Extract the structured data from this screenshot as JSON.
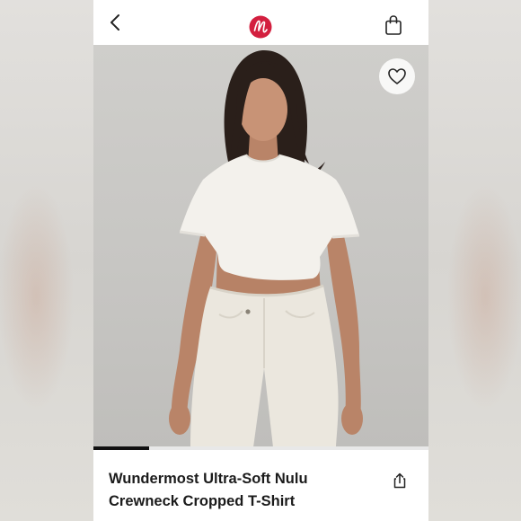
{
  "header": {
    "back_icon": "chevron-left-icon",
    "logo_icon": "lululemon-logo",
    "bag_icon": "shopping-bag-icon",
    "brand_color": "#d31f3f"
  },
  "gallery": {
    "favorite_icon": "heart-outline-icon",
    "progress": 0.167
  },
  "product": {
    "title_line1": "Wundermost Ultra-Soft Nulu",
    "title_line2": "Crewneck Cropped T-Shirt",
    "share_icon": "share-icon"
  }
}
